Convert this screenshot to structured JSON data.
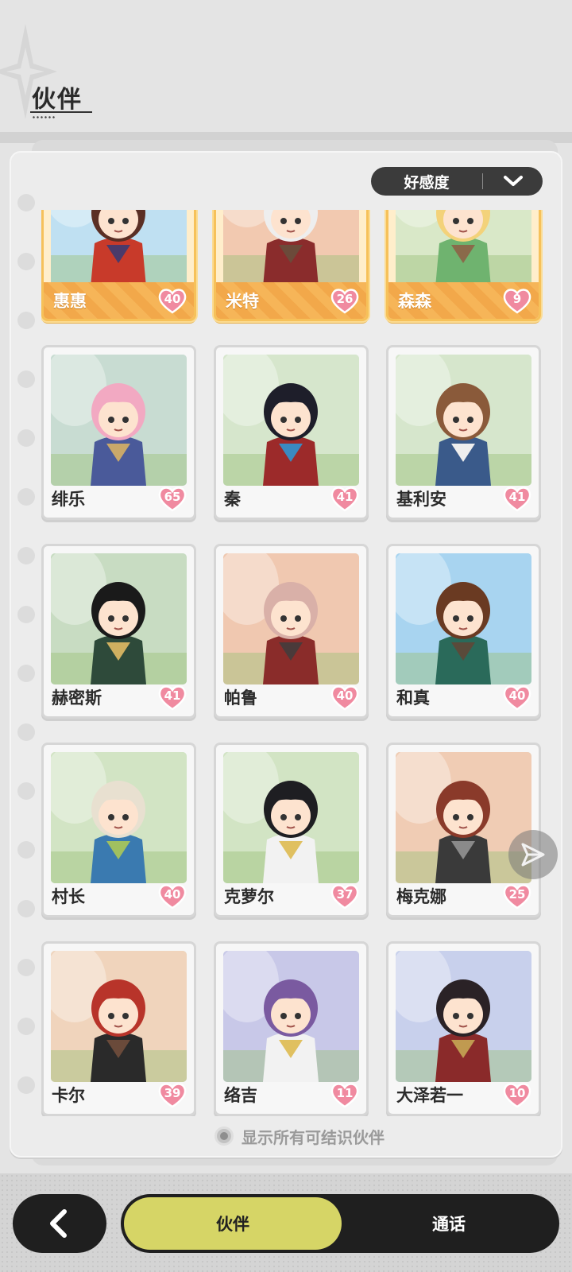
{
  "header": {
    "title": "伙伴"
  },
  "sort": {
    "label": "好感度"
  },
  "partners": [
    {
      "name": "惠惠",
      "affection": "40",
      "featured": true,
      "bg": "#bfe0f2",
      "hair": "#5a2f25",
      "outfit": "#c83a2a",
      "acc": "#4a3a6a"
    },
    {
      "name": "米特",
      "affection": "26",
      "featured": true,
      "bg": "#f2c9b0",
      "hair": "#eeeeee",
      "outfit": "#8a2c2c",
      "acc": "#6b4a3a"
    },
    {
      "name": "森森",
      "affection": "9",
      "featured": true,
      "bg": "#d9e8c8",
      "hair": "#f3d27a",
      "outfit": "#6fb36f",
      "acc": "#8a6a4a"
    },
    {
      "name": "绯乐",
      "affection": "65",
      "featured": false,
      "bg": "#c8dcd2",
      "hair": "#f2a9c2",
      "outfit": "#4a5a9a",
      "acc": "#c9a86a"
    },
    {
      "name": "秦",
      "affection": "41",
      "featured": false,
      "bg": "#d6e6cc",
      "hair": "#1e1e2a",
      "outfit": "#9c2a2a",
      "acc": "#3a8ac0"
    },
    {
      "name": "基利安",
      "affection": "41",
      "featured": false,
      "bg": "#d6e6cc",
      "hair": "#8a5a3a",
      "outfit": "#3a5a8a",
      "acc": "#eeeeee"
    },
    {
      "name": "赫密斯",
      "affection": "41",
      "featured": false,
      "bg": "#c8dcc2",
      "hair": "#1a1a1a",
      "outfit": "#2e4a3a",
      "acc": "#d0b060"
    },
    {
      "name": "帕鲁",
      "affection": "40",
      "featured": false,
      "bg": "#f0c8b0",
      "hair": "#d9b0a8",
      "outfit": "#8a2c2a",
      "acc": "#4a3a3a"
    },
    {
      "name": "和真",
      "affection": "40",
      "featured": false,
      "bg": "#a8d4f0",
      "hair": "#6a3a22",
      "outfit": "#2a6a5a",
      "acc": "#5a4a3a"
    },
    {
      "name": "村长",
      "affection": "40",
      "featured": false,
      "bg": "#d2e4c4",
      "hair": "#e8e0d0",
      "outfit": "#3a7ab0",
      "acc": "#a0c060"
    },
    {
      "name": "克萝尔",
      "affection": "37",
      "featured": false,
      "bg": "#d2e4c4",
      "hair": "#1e1e22",
      "outfit": "#f2f2f2",
      "acc": "#e0c060"
    },
    {
      "name": "梅克娜",
      "affection": "25",
      "featured": false,
      "bg": "#f0ccb4",
      "hair": "#8a3a2a",
      "outfit": "#3a3a3a",
      "acc": "#8a8a8a"
    },
    {
      "name": "卡尔",
      "affection": "39",
      "featured": false,
      "bg": "#f0d4bc",
      "hair": "#b8342a",
      "outfit": "#2a2a2a",
      "acc": "#6a4a3a"
    },
    {
      "name": "络吉",
      "affection": "11",
      "featured": false,
      "bg": "#c8c8e8",
      "hair": "#7a5aa0",
      "outfit": "#f2f2f2",
      "acc": "#e0c060"
    },
    {
      "name": "大泽若一",
      "affection": "10",
      "featured": false,
      "bg": "#c8d0ec",
      "hair": "#2a2226",
      "outfit": "#8a2a2a",
      "acc": "#c09a50"
    }
  ],
  "footer": {
    "show_all_label": "显示所有可结识伙伴"
  },
  "nav": {
    "back_icon": "back-arrow-icon",
    "tab_partners": "伙伴",
    "tab_call": "通话"
  },
  "colors": {
    "accent": "#d6d566",
    "featured": "#f6c15a",
    "heart": "#f08aa0",
    "dark": "#1f1f1f"
  }
}
